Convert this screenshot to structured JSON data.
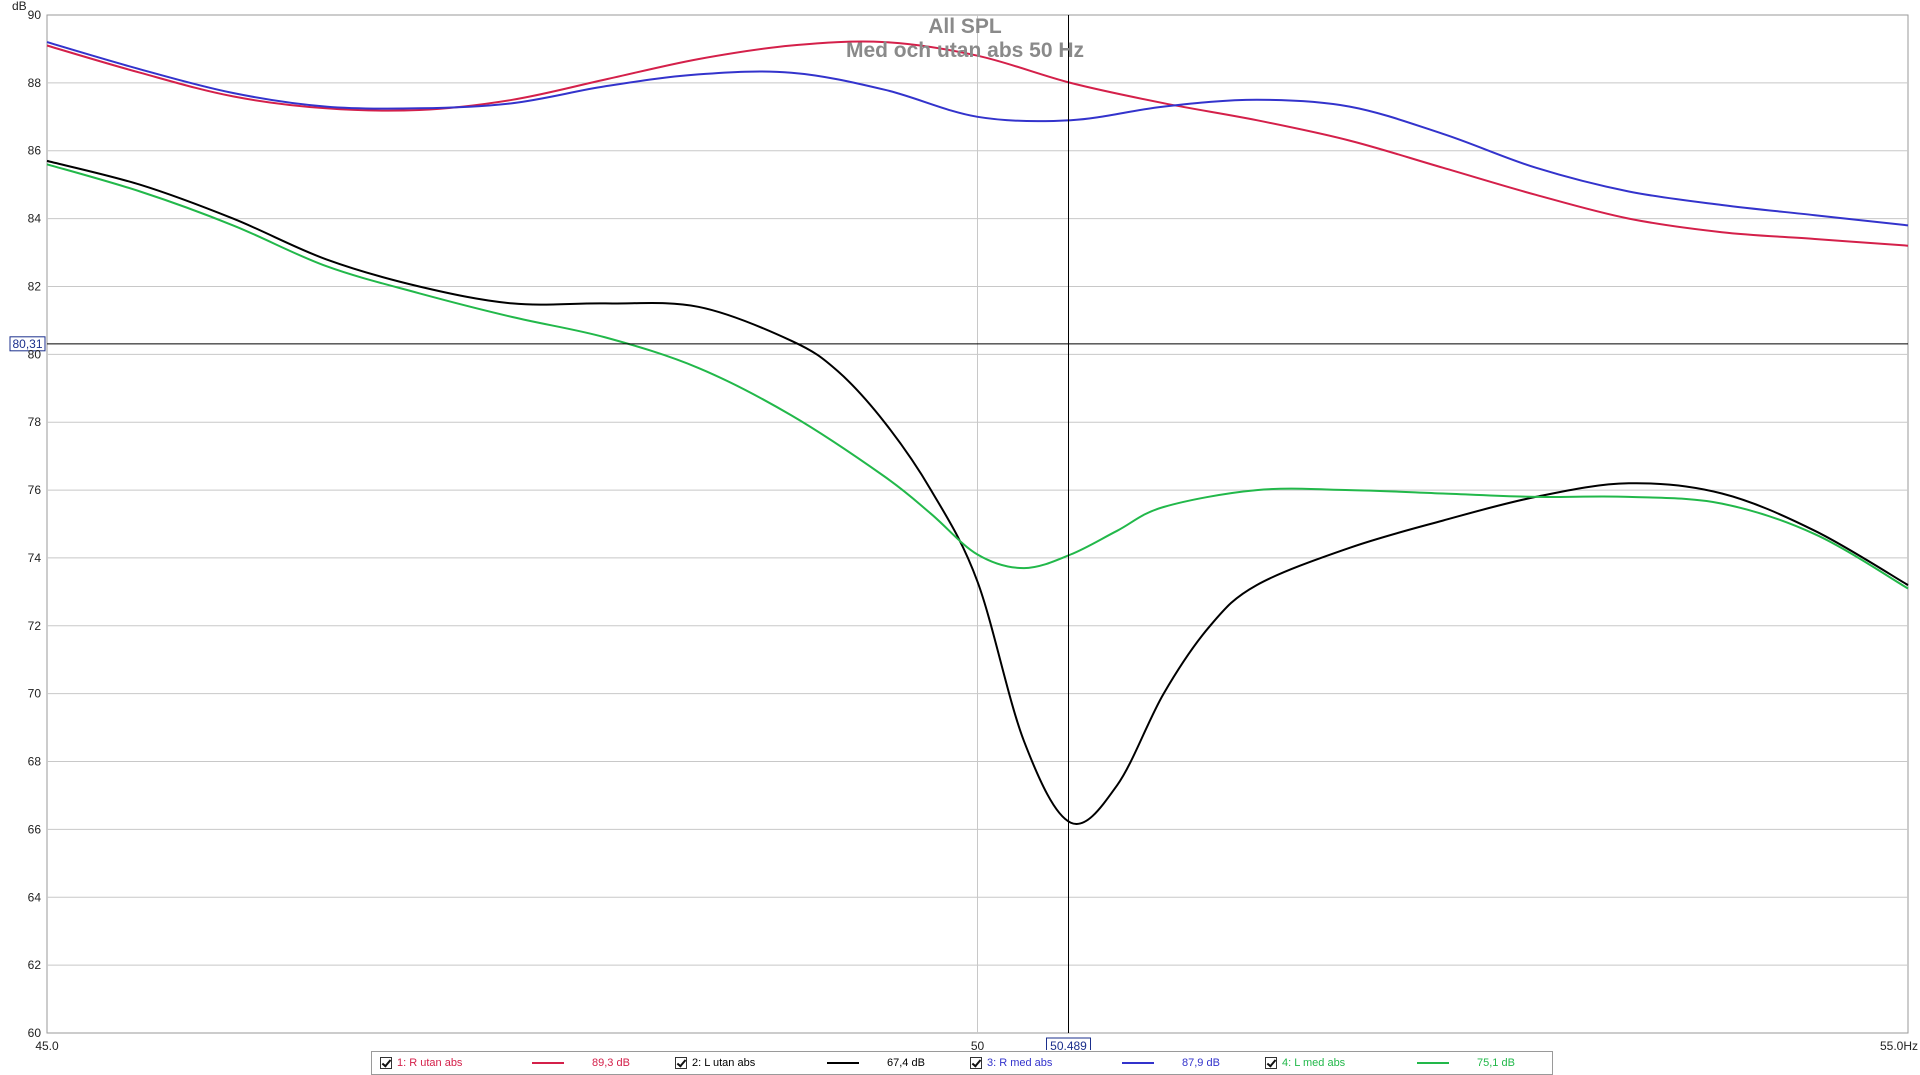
{
  "chart_data": {
    "type": "line",
    "title": "All SPL",
    "subtitle": "Med och utan abs 50 Hz",
    "ylabel": "dB",
    "xunit": "Hz",
    "xlim": [
      45.0,
      55.0
    ],
    "ylim": [
      60,
      90
    ],
    "grid": true,
    "y_ticks": [
      {
        "value": 60,
        "label": "60"
      },
      {
        "value": 62,
        "label": "62"
      },
      {
        "value": 64,
        "label": "64"
      },
      {
        "value": 66,
        "label": "66"
      },
      {
        "value": 68,
        "label": "68"
      },
      {
        "value": 70,
        "label": "70"
      },
      {
        "value": 72,
        "label": "72"
      },
      {
        "value": 74,
        "label": "74"
      },
      {
        "value": 76,
        "label": "76"
      },
      {
        "value": 78,
        "label": "78"
      },
      {
        "value": 80,
        "label": "80"
      },
      {
        "value": 82,
        "label": "82"
      },
      {
        "value": 84,
        "label": "84"
      },
      {
        "value": 86,
        "label": "86"
      },
      {
        "value": 88,
        "label": "88"
      },
      {
        "value": 90,
        "label": "90"
      }
    ],
    "x_ticks": [
      {
        "value": 45.0,
        "label": "45,0"
      },
      {
        "value": 50.0,
        "label": "50"
      },
      {
        "value": 55.0,
        "label": "55,0Hz"
      }
    ],
    "cursor": {
      "x": 50.489,
      "x_label": "50,489",
      "y": 80.31,
      "y_label": "80,31"
    },
    "legend_placement": "bottom",
    "series": [
      {
        "name": "1: R utan abs",
        "value_label": "89,3 dB",
        "color": "#d4204a",
        "x": [
          45.0,
          45.5,
          46.0,
          46.5,
          47.0,
          47.5,
          48.0,
          48.5,
          49.0,
          49.5,
          50.0,
          50.5,
          51.0,
          51.5,
          52.0,
          52.5,
          53.0,
          53.5,
          54.0,
          54.5,
          55.0
        ],
        "y": [
          89.1,
          88.3,
          87.6,
          87.25,
          87.2,
          87.5,
          88.1,
          88.7,
          89.1,
          89.2,
          88.8,
          88.0,
          87.4,
          86.9,
          86.3,
          85.5,
          84.7,
          84.0,
          83.6,
          83.4,
          83.2
        ]
      },
      {
        "name": "2: L utan abs",
        "value_label": "67,4 dB",
        "color": "#000000",
        "x": [
          45.0,
          45.5,
          46.0,
          46.5,
          47.0,
          47.5,
          48.0,
          48.5,
          49.0,
          49.25,
          49.5,
          49.75,
          50.0,
          50.25,
          50.5,
          50.75,
          51.0,
          51.25,
          51.5,
          52.0,
          52.5,
          53.0,
          53.5,
          54.0,
          54.5,
          55.0
        ],
        "y": [
          85.7,
          85.0,
          84.0,
          82.8,
          82.0,
          81.5,
          81.5,
          81.4,
          80.4,
          79.5,
          78.0,
          76.0,
          73.3,
          68.6,
          66.2,
          67.3,
          70.0,
          72.0,
          73.2,
          74.3,
          75.1,
          75.8,
          76.2,
          75.9,
          74.8,
          73.2
        ]
      },
      {
        "name": "3: R med abs",
        "value_label": "87,9 dB",
        "color": "#3333cc",
        "x": [
          45.0,
          45.5,
          46.0,
          46.5,
          47.0,
          47.5,
          48.0,
          48.5,
          49.0,
          49.5,
          50.0,
          50.5,
          51.0,
          51.5,
          52.0,
          52.5,
          53.0,
          53.5,
          54.0,
          54.5,
          55.0
        ],
        "y": [
          89.2,
          88.4,
          87.7,
          87.3,
          87.25,
          87.4,
          87.9,
          88.25,
          88.3,
          87.8,
          87.0,
          86.9,
          87.3,
          87.5,
          87.3,
          86.5,
          85.5,
          84.8,
          84.4,
          84.1,
          83.8
        ]
      },
      {
        "name": "4: L med abs",
        "value_label": "75,1 dB",
        "color": "#22b84a",
        "x": [
          45.0,
          45.5,
          46.0,
          46.5,
          47.0,
          47.5,
          48.0,
          48.5,
          49.0,
          49.5,
          49.75,
          50.0,
          50.25,
          50.5,
          50.75,
          51.0,
          51.5,
          52.0,
          52.5,
          53.0,
          53.5,
          54.0,
          54.5,
          55.0
        ],
        "y": [
          85.6,
          84.8,
          83.8,
          82.6,
          81.8,
          81.1,
          80.5,
          79.6,
          78.2,
          76.4,
          75.3,
          74.1,
          73.7,
          74.1,
          74.8,
          75.5,
          76.0,
          76.0,
          75.9,
          75.8,
          75.8,
          75.6,
          74.7,
          73.1
        ]
      }
    ]
  }
}
